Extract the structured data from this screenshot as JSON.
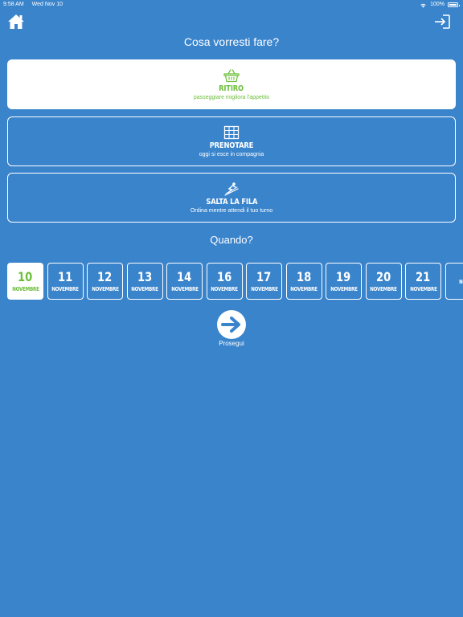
{
  "status_bar": {
    "time": "9:58 AM",
    "date": "Wed Nov 10",
    "battery": "100%"
  },
  "header": {
    "home_icon": "home-icon",
    "logout_icon": "logout-icon"
  },
  "title": "Cosa vorresti fare?",
  "options": [
    {
      "id": "ritiro",
      "icon": "basket-icon",
      "title": "RITIRO",
      "subtitle": "passeggiare migliora l'appetito",
      "selected": true
    },
    {
      "id": "prenotare",
      "icon": "table-grid-icon",
      "title": "PRENOTARE",
      "subtitle": "oggi si esce in compagnia",
      "selected": false
    },
    {
      "id": "salta",
      "icon": "ski-jump-icon",
      "title": "SALTA LA FILA",
      "subtitle": "Ordina mentre attendi il tuo turno",
      "selected": false
    }
  ],
  "when_title": "Quando?",
  "dates": [
    {
      "day": "10",
      "month": "NOVEMBRE",
      "selected": true
    },
    {
      "day": "11",
      "month": "NOVEMBRE"
    },
    {
      "day": "12",
      "month": "NOVEMBRE"
    },
    {
      "day": "13",
      "month": "NOVEMBRE"
    },
    {
      "day": "14",
      "month": "NOVEMBRE"
    },
    {
      "day": "16",
      "month": "NOVEMBRE"
    },
    {
      "day": "17",
      "month": "NOVEMBRE"
    },
    {
      "day": "18",
      "month": "NOVEMBRE"
    },
    {
      "day": "19",
      "month": "NOVEMBRE"
    },
    {
      "day": "20",
      "month": "NOVEMBRE"
    },
    {
      "day": "21",
      "month": "NOVEMBRE"
    },
    {
      "day": "",
      "month": "NO"
    }
  ],
  "next": {
    "icon": "arrow-right-icon",
    "label": "Prosegui"
  },
  "colors": {
    "background": "#3a84cc",
    "accent": "#6cbf3b",
    "card": "#ffffff"
  }
}
